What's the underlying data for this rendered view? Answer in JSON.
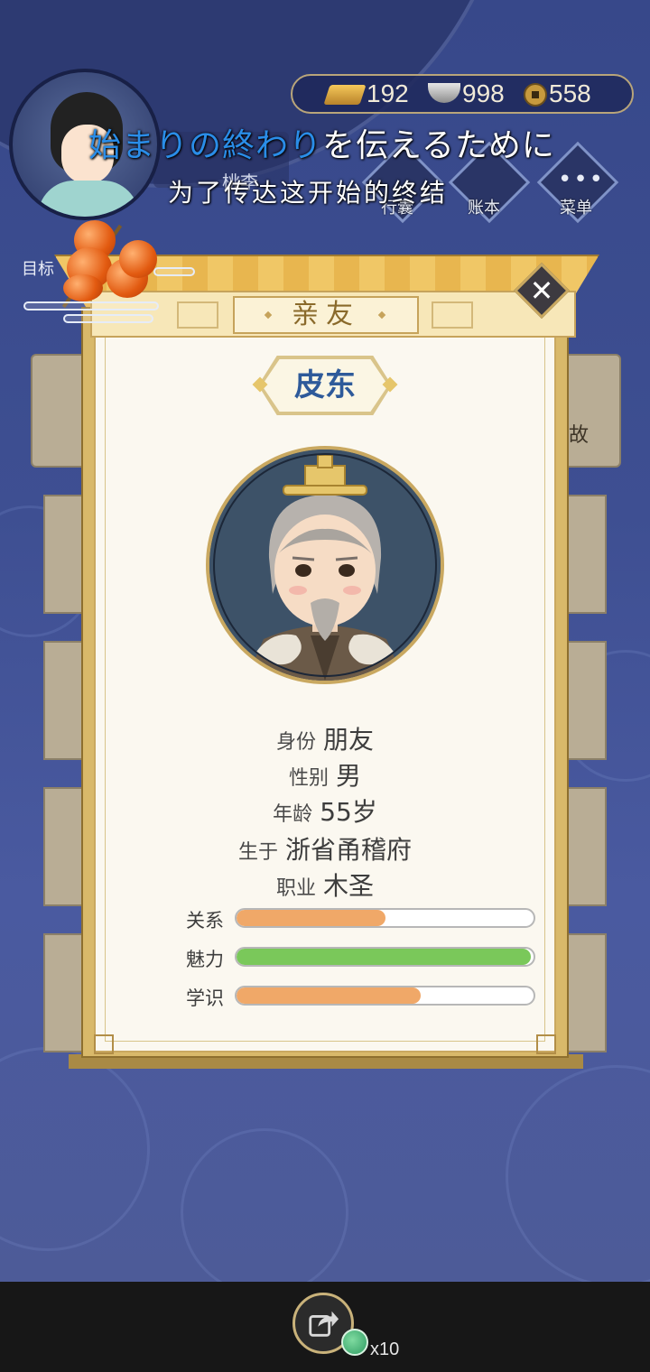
{
  "currency": {
    "gold": "192",
    "silver": "998",
    "copper": "558"
  },
  "subtitles": {
    "japanese_highlight": "始まりの終わり",
    "japanese_rest": "を伝えるために",
    "chinese": "为了传达这开始的终结"
  },
  "background_ui": {
    "plate_text": "桃李",
    "menu_items": [
      {
        "label": "行囊",
        "icon": "bag-icon"
      },
      {
        "label": "账本",
        "icon": "ledger-icon"
      },
      {
        "label": "菜单",
        "icon": "more-dots-icon"
      }
    ],
    "goal_label": "目标",
    "side_text": "故"
  },
  "dialog": {
    "title": "亲友",
    "close_icon": "close-icon",
    "person_name": "皮东",
    "info": [
      {
        "key": "身份",
        "value": "朋友"
      },
      {
        "key": "性别",
        "value": "男"
      },
      {
        "key": "年龄",
        "value": "55岁"
      },
      {
        "key": "生于",
        "value": "浙省甬稽府"
      },
      {
        "key": "职业",
        "value": "木圣"
      }
    ],
    "stats": [
      {
        "label": "关系",
        "level": 0.5,
        "color": "#f0a868"
      },
      {
        "label": "魅力",
        "level": 0.99,
        "color": "#7ac85a"
      },
      {
        "label": "学识",
        "level": 0.62,
        "color": "#f0a868"
      }
    ]
  },
  "bottom_bar": {
    "share_icon": "share-icon",
    "count": "x10"
  },
  "colors": {
    "background": "#3e4f92",
    "dialog_gold": "#d9b96a",
    "name_blue": "#2e5a9a",
    "subtitle_highlight": "#2a8de8"
  }
}
